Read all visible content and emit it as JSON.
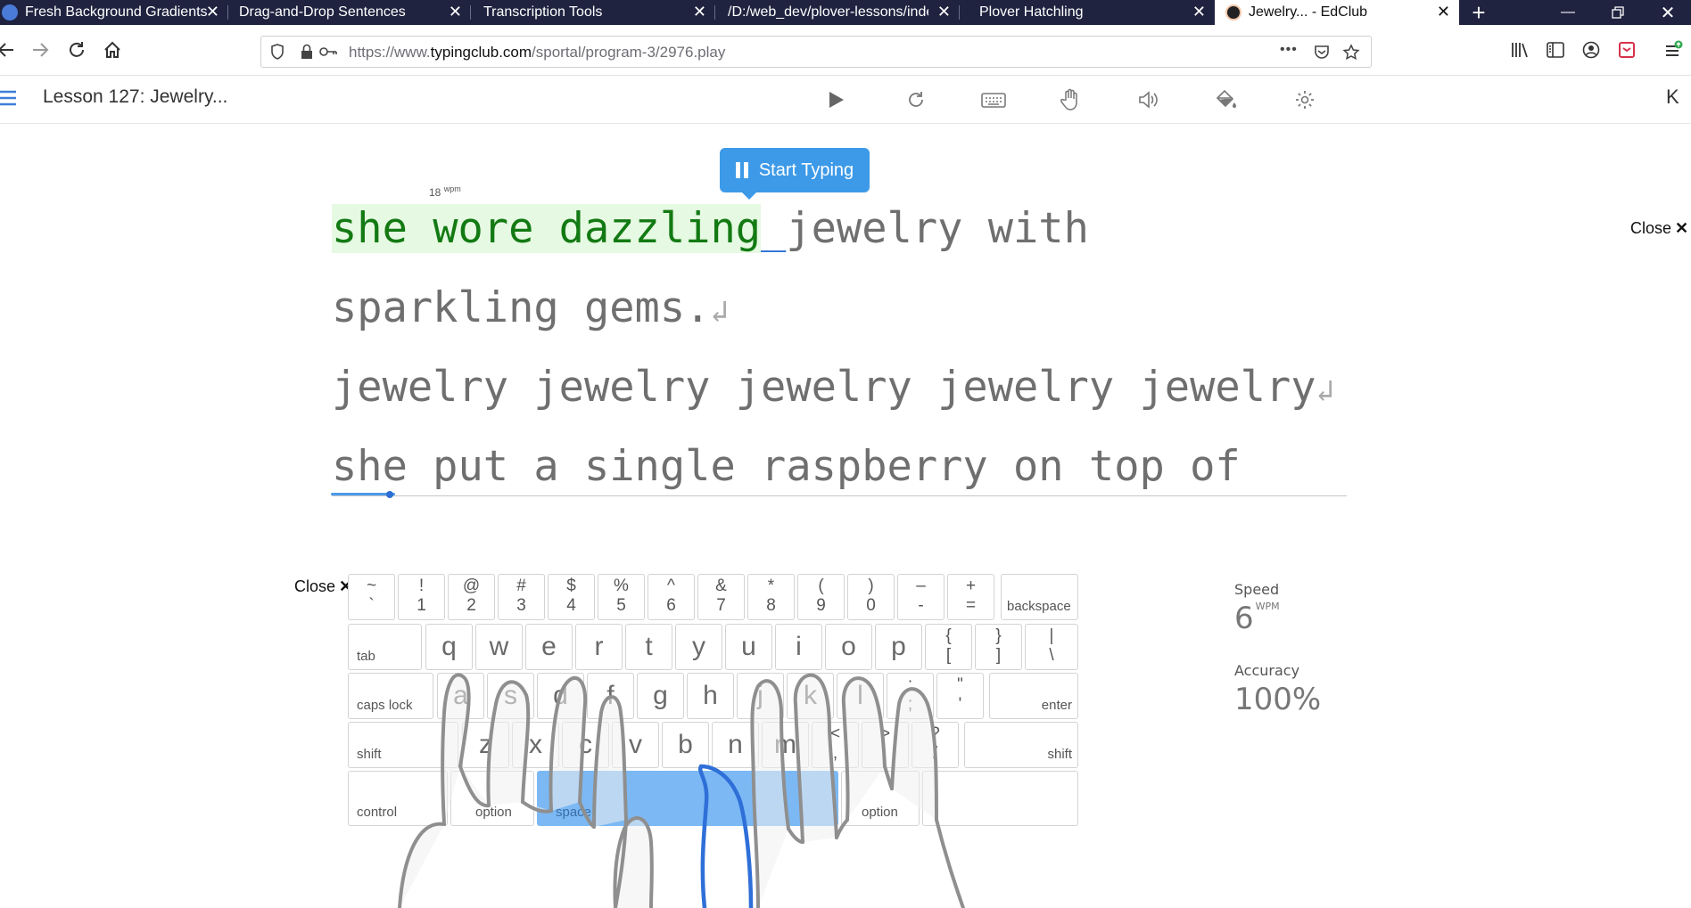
{
  "browser": {
    "tabs": [
      {
        "title": "Fresh Background Gradients | W",
        "active": false
      },
      {
        "title": "Drag-and-Drop Sentences",
        "active": false
      },
      {
        "title": "Transcription Tools",
        "active": false
      },
      {
        "title": "/D:/web_dev/plover-lessons/index",
        "active": false
      },
      {
        "title": "Plover Hatchling",
        "active": false
      },
      {
        "title": "Jewelry... - EdClub",
        "active": true
      }
    ],
    "new_tab_label": "+",
    "url_prefix": "https://www.",
    "url_host": "typingclub.com",
    "url_path": "/sportal/program-3/2976.play",
    "overflow_label": "•••"
  },
  "app": {
    "lesson_title": "Lesson 127: Jewelry...",
    "user_initial": "K",
    "start_typing_label": "Start Typing",
    "wpm_value": "18",
    "wpm_unit": "wpm",
    "close_label": "Close",
    "close_symbol": "✕"
  },
  "text": {
    "line1_typed": [
      "she",
      " ",
      "wore",
      " ",
      "dazzling"
    ],
    "line1_cursor": "_",
    "line1_rest": "jewelry with",
    "line2": "sparkling gems.",
    "line3": "jewelry jewelry jewelry jewelry jewelry",
    "line4": "she put a single raspberry on top of",
    "return_symbol": "↲"
  },
  "stats": {
    "speed_label": "Speed",
    "speed_value": "6",
    "speed_unit": "WPM",
    "accuracy_label": "Accuracy",
    "accuracy_value": "100%"
  },
  "keyboard": {
    "row1": [
      {
        "up": "~",
        "dn": "`"
      },
      {
        "up": "!",
        "dn": "1"
      },
      {
        "up": "@",
        "dn": "2"
      },
      {
        "up": "#",
        "dn": "3"
      },
      {
        "up": "$",
        "dn": "4"
      },
      {
        "up": "%",
        "dn": "5"
      },
      {
        "up": "^",
        "dn": "6"
      },
      {
        "up": "&",
        "dn": "7"
      },
      {
        "up": "*",
        "dn": "8"
      },
      {
        "up": "(",
        "dn": "9"
      },
      {
        "up": ")",
        "dn": "0"
      },
      {
        "up": "–",
        "dn": "-"
      },
      {
        "up": "+",
        "dn": "="
      }
    ],
    "backspace": "backspace",
    "tab": "tab",
    "row2": [
      "q",
      "w",
      "e",
      "r",
      "t",
      "y",
      "u",
      "i",
      "o",
      "p"
    ],
    "row2_sym": [
      {
        "up": "{",
        "dn": "["
      },
      {
        "up": "}",
        "dn": "]"
      },
      {
        "up": "|",
        "dn": "\\"
      }
    ],
    "caps": "caps lock",
    "row3": [
      "a",
      "s",
      "d",
      "f",
      "g",
      "h",
      "j",
      "k",
      "l"
    ],
    "row3_sym": [
      {
        "up": ":",
        "dn": ";"
      },
      {
        "up": "\"",
        "dn": "'"
      }
    ],
    "enter": "enter",
    "shift": "shift",
    "row4": [
      "z",
      "x",
      "c",
      "v",
      "b",
      "n",
      "m"
    ],
    "row4_sym": [
      {
        "up": "<",
        "dn": ","
      },
      {
        "up": ">",
        "dn": "."
      },
      {
        "up": "?",
        "dn": "/"
      }
    ],
    "control": "control",
    "option": "option",
    "space": "space"
  },
  "colors": {
    "tabstrip": "#202340",
    "accent": "#3d9ae8",
    "typed_text": "#137a13",
    "typed_bg": "#e6f9e2",
    "space_key": "#7cb9f4"
  }
}
